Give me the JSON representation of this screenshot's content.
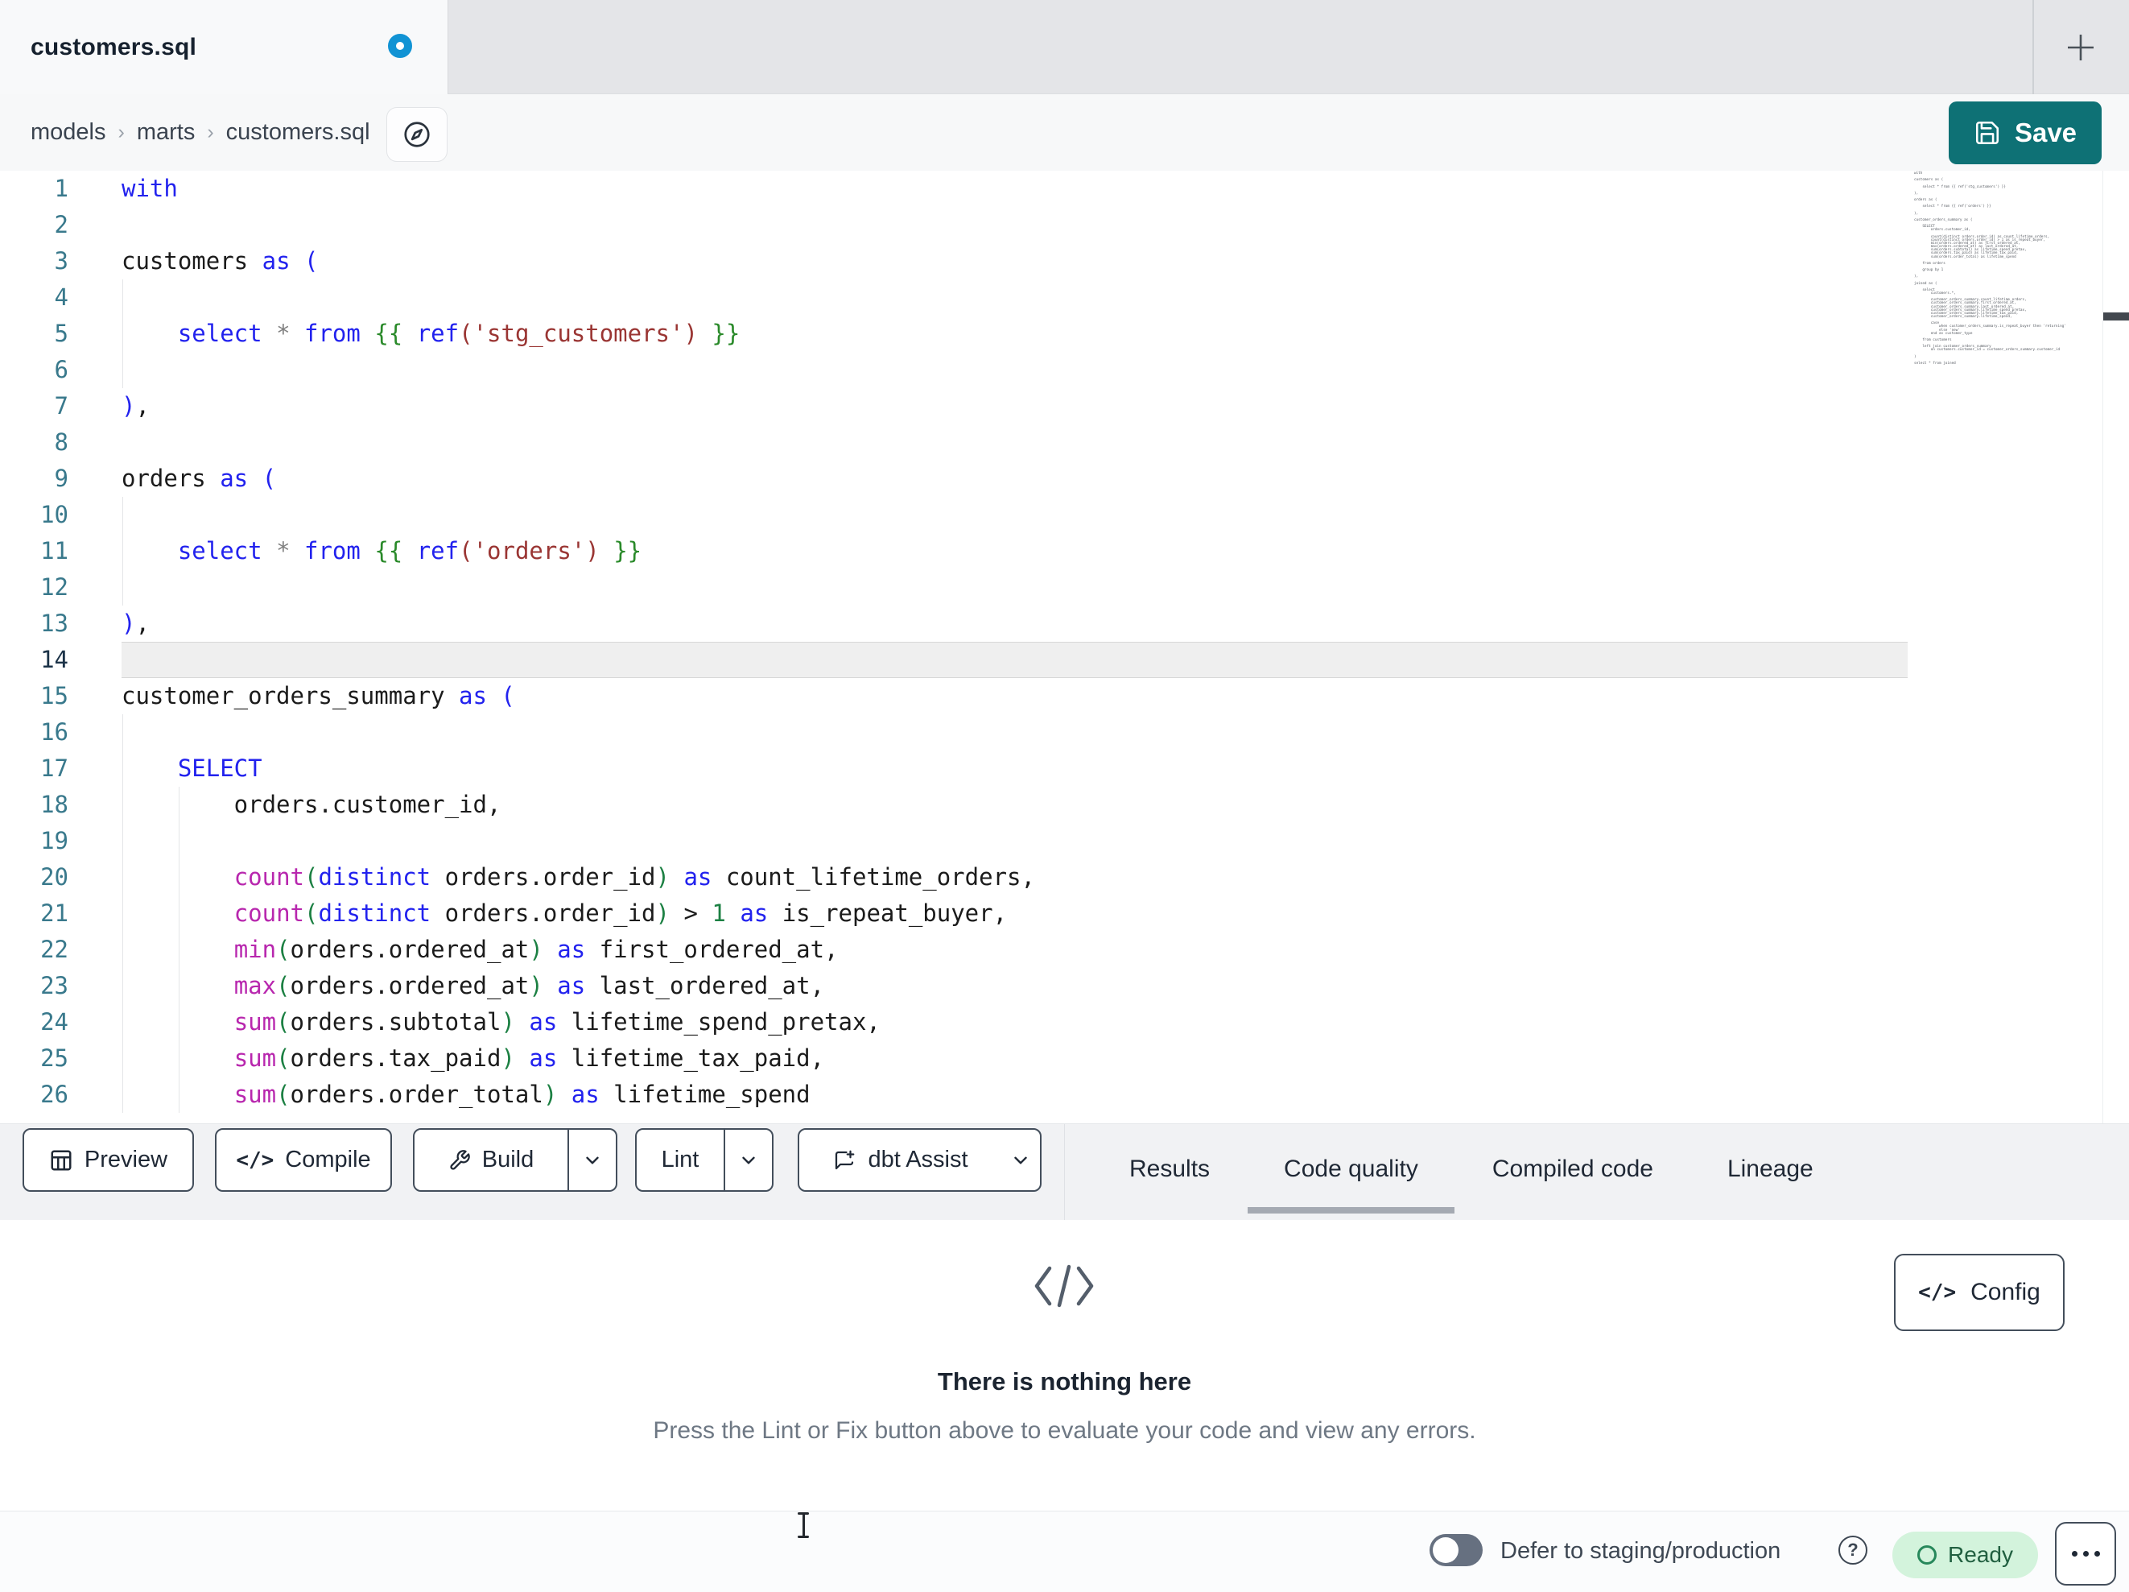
{
  "tab_bar": {
    "active_tab": "customers.sql",
    "unsaved_indicator": true,
    "new_tab_icon": "plus-icon"
  },
  "breadcrumb": {
    "items": [
      "models",
      "marts",
      "customers.sql"
    ],
    "separator": "›",
    "action_icon": "compass-icon"
  },
  "actions": {
    "save_label": "Save"
  },
  "editor": {
    "active_line": 14,
    "lines": [
      {
        "n": 1,
        "guides": [],
        "tokens": [
          [
            "kw",
            "with"
          ]
        ]
      },
      {
        "n": 2,
        "guides": [],
        "tokens": []
      },
      {
        "n": 3,
        "guides": [],
        "tokens": [
          [
            "txt",
            "customers "
          ],
          [
            "kw",
            "as"
          ],
          [
            "txt",
            " "
          ],
          [
            "kw",
            "("
          ]
        ]
      },
      {
        "n": 4,
        "guides": [
          0
        ],
        "tokens": []
      },
      {
        "n": 5,
        "guides": [
          0
        ],
        "tokens": [
          [
            "txt",
            "    "
          ],
          [
            "kw",
            "select"
          ],
          [
            "txt",
            " "
          ],
          [
            "op",
            "*"
          ],
          [
            "txt",
            " "
          ],
          [
            "kw",
            "from"
          ],
          [
            "txt",
            " "
          ],
          [
            "jinja",
            "{{"
          ],
          [
            "txt",
            " "
          ],
          [
            "kw",
            "ref"
          ],
          [
            "str",
            "('stg_customers')"
          ],
          [
            "txt",
            " "
          ],
          [
            "jinja",
            "}}"
          ]
        ]
      },
      {
        "n": 6,
        "guides": [
          0
        ],
        "tokens": []
      },
      {
        "n": 7,
        "guides": [],
        "tokens": [
          [
            "kw",
            ")"
          ],
          [
            "txt",
            ","
          ]
        ]
      },
      {
        "n": 8,
        "guides": [],
        "tokens": []
      },
      {
        "n": 9,
        "guides": [],
        "tokens": [
          [
            "txt",
            "orders "
          ],
          [
            "kw",
            "as"
          ],
          [
            "txt",
            " "
          ],
          [
            "kw",
            "("
          ]
        ]
      },
      {
        "n": 10,
        "guides": [
          0
        ],
        "tokens": []
      },
      {
        "n": 11,
        "guides": [
          0
        ],
        "tokens": [
          [
            "txt",
            "    "
          ],
          [
            "kw",
            "select"
          ],
          [
            "txt",
            " "
          ],
          [
            "op",
            "*"
          ],
          [
            "txt",
            " "
          ],
          [
            "kw",
            "from"
          ],
          [
            "txt",
            " "
          ],
          [
            "jinja",
            "{{"
          ],
          [
            "txt",
            " "
          ],
          [
            "kw",
            "ref"
          ],
          [
            "str",
            "('orders')"
          ],
          [
            "txt",
            " "
          ],
          [
            "jinja",
            "}}"
          ]
        ]
      },
      {
        "n": 12,
        "guides": [
          0
        ],
        "tokens": []
      },
      {
        "n": 13,
        "guides": [],
        "tokens": [
          [
            "kw",
            ")"
          ],
          [
            "txt",
            ","
          ]
        ]
      },
      {
        "n": 14,
        "guides": [],
        "tokens": []
      },
      {
        "n": 15,
        "guides": [],
        "tokens": [
          [
            "txt",
            "customer_orders_summary "
          ],
          [
            "kw",
            "as"
          ],
          [
            "txt",
            " "
          ],
          [
            "kw",
            "("
          ]
        ]
      },
      {
        "n": 16,
        "guides": [
          0
        ],
        "tokens": []
      },
      {
        "n": 17,
        "guides": [
          0
        ],
        "tokens": [
          [
            "txt",
            "    "
          ],
          [
            "kw",
            "SELECT"
          ]
        ]
      },
      {
        "n": 18,
        "guides": [
          0,
          1
        ],
        "tokens": [
          [
            "txt",
            "        orders.customer_id,"
          ]
        ]
      },
      {
        "n": 19,
        "guides": [
          0,
          1
        ],
        "tokens": []
      },
      {
        "n": 20,
        "guides": [
          0,
          1
        ],
        "tokens": [
          [
            "txt",
            "        "
          ],
          [
            "fn",
            "count"
          ],
          [
            "par",
            "("
          ],
          [
            "kw",
            "distinct"
          ],
          [
            "txt",
            " orders.order_id"
          ],
          [
            "par",
            ")"
          ],
          [
            "txt",
            " "
          ],
          [
            "kw",
            "as"
          ],
          [
            "txt",
            " count_lifetime_orders,"
          ]
        ]
      },
      {
        "n": 21,
        "guides": [
          0,
          1
        ],
        "tokens": [
          [
            "txt",
            "        "
          ],
          [
            "fn",
            "count"
          ],
          [
            "par",
            "("
          ],
          [
            "kw",
            "distinct"
          ],
          [
            "txt",
            " orders.order_id"
          ],
          [
            "par",
            ")"
          ],
          [
            "txt",
            " > "
          ],
          [
            "num",
            "1"
          ],
          [
            "txt",
            " "
          ],
          [
            "kw",
            "as"
          ],
          [
            "txt",
            " is_repeat_buyer,"
          ]
        ]
      },
      {
        "n": 22,
        "guides": [
          0,
          1
        ],
        "tokens": [
          [
            "txt",
            "        "
          ],
          [
            "fn",
            "min"
          ],
          [
            "par",
            "("
          ],
          [
            "txt",
            "orders.ordered_at"
          ],
          [
            "par",
            ")"
          ],
          [
            "txt",
            " "
          ],
          [
            "kw",
            "as"
          ],
          [
            "txt",
            " first_ordered_at,"
          ]
        ]
      },
      {
        "n": 23,
        "guides": [
          0,
          1
        ],
        "tokens": [
          [
            "txt",
            "        "
          ],
          [
            "fn",
            "max"
          ],
          [
            "par",
            "("
          ],
          [
            "txt",
            "orders.ordered_at"
          ],
          [
            "par",
            ")"
          ],
          [
            "txt",
            " "
          ],
          [
            "kw",
            "as"
          ],
          [
            "txt",
            " last_ordered_at,"
          ]
        ]
      },
      {
        "n": 24,
        "guides": [
          0,
          1
        ],
        "tokens": [
          [
            "txt",
            "        "
          ],
          [
            "fn",
            "sum"
          ],
          [
            "par",
            "("
          ],
          [
            "txt",
            "orders.subtotal"
          ],
          [
            "par",
            ")"
          ],
          [
            "txt",
            " "
          ],
          [
            "kw",
            "as"
          ],
          [
            "txt",
            " lifetime_spend_pretax,"
          ]
        ]
      },
      {
        "n": 25,
        "guides": [
          0,
          1
        ],
        "tokens": [
          [
            "txt",
            "        "
          ],
          [
            "fn",
            "sum"
          ],
          [
            "par",
            "("
          ],
          [
            "txt",
            "orders.tax_paid"
          ],
          [
            "par",
            ")"
          ],
          [
            "txt",
            " "
          ],
          [
            "kw",
            "as"
          ],
          [
            "txt",
            " lifetime_tax_paid,"
          ]
        ]
      },
      {
        "n": 26,
        "guides": [
          0,
          1
        ],
        "tokens": [
          [
            "txt",
            "        "
          ],
          [
            "fn",
            "sum"
          ],
          [
            "par",
            "("
          ],
          [
            "txt",
            "orders.order_total"
          ],
          [
            "par",
            ")"
          ],
          [
            "txt",
            " "
          ],
          [
            "kw",
            "as"
          ],
          [
            "txt",
            " lifetime_spend"
          ]
        ]
      }
    ]
  },
  "minimap": {
    "lines": [
      "with",
      "",
      "customers as (",
      "",
      "    select * from {{ ref('stg_customers') }}",
      "",
      "),",
      "",
      "orders as (",
      "",
      "    select * from {{ ref('orders') }}",
      "",
      "),",
      "",
      "customer_orders_summary as (",
      "",
      "    SELECT",
      "        orders.customer_id,",
      "",
      "        count(distinct orders.order_id) as count_lifetime_orders,",
      "        count(distinct orders.order_id) > 1 as is_repeat_buyer,",
      "        min(orders.ordered_at) as first_ordered_at,",
      "        max(orders.ordered_at) as last_ordered_at,",
      "        sum(orders.subtotal) as lifetime_spend_pretax,",
      "        sum(orders.tax_paid) as lifetime_tax_paid,",
      "        sum(orders.order_total) as lifetime_spend",
      "",
      "    from orders",
      "",
      "    group by 1",
      "",
      "),",
      "",
      "joined as (",
      "",
      "    select",
      "        customers.*,",
      "",
      "        customer_orders_summary.count_lifetime_orders,",
      "        customer_orders_summary.first_ordered_at,",
      "        customer_orders_summary.last_ordered_at,",
      "        customer_orders_summary.lifetime_spend_pretax,",
      "        customer_orders_summary.lifetime_tax_paid,",
      "        customer_orders_summary.lifetime_spend,",
      "",
      "        case",
      "            when customer_orders_summary.is_repeat_buyer then 'returning'",
      "            else 'new'",
      "        end as customer_type",
      "",
      "    from customers",
      "",
      "    left join customer_orders_summary",
      "        on customers.customer_id = customer_orders_summary.customer_id",
      "",
      ")",
      "",
      "select * from joined"
    ]
  },
  "toolbar": {
    "preview_label": "Preview",
    "compile_label": "Compile",
    "build_label": "Build",
    "lint_label": "Lint",
    "assist_label": "dbt Assist",
    "tabs": [
      {
        "label": "Results",
        "active": false
      },
      {
        "label": "Code quality",
        "active": true
      },
      {
        "label": "Compiled code",
        "active": false
      },
      {
        "label": "Lineage",
        "active": false
      }
    ]
  },
  "panel": {
    "config_label": "Config",
    "empty_state": {
      "icon": "code-icon",
      "title": "There is nothing here",
      "subtitle": "Press the Lint or Fix button above to evaluate your code and view any errors."
    }
  },
  "status_bar": {
    "defer_toggle_on": false,
    "defer_label": "Defer to staging/production",
    "help_icon": "question-circle-icon",
    "ready_label": "Ready",
    "more_icon": "ellipsis-icon"
  },
  "colors": {
    "accent_teal": "#0E7175",
    "unsaved_dot_blue": "#1193D4",
    "ready_badge_bg": "#D3F3DC",
    "ready_badge_text": "#215F40",
    "syntax_keyword": "#2222EE",
    "syntax_function": "#B827AE",
    "syntax_string": "#9A3533",
    "syntax_paren": "#1C8043",
    "syntax_jinja": "#2A8A2A",
    "syntax_number": "#1C8043",
    "line_number": "#39798C",
    "active_line_number": "#1C3348"
  }
}
